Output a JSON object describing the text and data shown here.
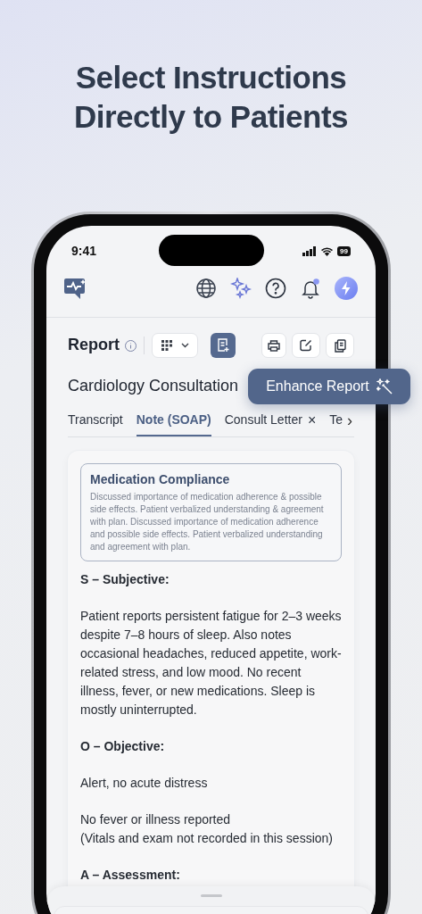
{
  "headline": "Select Instructions Directly to Patients",
  "status_bar": {
    "time": "9:41",
    "battery": "99"
  },
  "toolbar": {
    "has_notification": true
  },
  "report": {
    "title": "Report"
  },
  "consultation_title": "Cardiology Consultation",
  "enhance_button": {
    "label": "Enhance Report"
  },
  "tabs": [
    {
      "label": "Transcript",
      "selected": false,
      "closable": false
    },
    {
      "label": "Note (SOAP)",
      "selected": true,
      "closable": false
    },
    {
      "label": "Consult Letter",
      "selected": false,
      "closable": true
    },
    {
      "label": "Te",
      "selected": false,
      "closable": false
    }
  ],
  "tab_close": "×",
  "tab_more": "›",
  "note": {
    "callout": {
      "title": "Medication Compliance",
      "text": "Discussed importance of medication adherence & possible side effects. Patient verbalized understanding & agreement with plan. Discussed importance of medication adherence and possible side effects. Patient verbalized understanding and agreement with plan."
    },
    "blocks": [
      {
        "kind": "heading",
        "text": "S – Subjective:"
      },
      {
        "kind": "paragraph",
        "text": "Patient reports persistent fatigue for 2–3 weeks despite 7–8 hours of sleep. Also notes occasional headaches, reduced appetite, work-related stress, and low mood. No recent illness, fever, or new medications. Sleep is mostly uninterrupted."
      },
      {
        "kind": "heading",
        "text": "O – Objective:"
      },
      {
        "kind": "paragraph",
        "text": "Alert, no acute distress"
      },
      {
        "kind": "lines",
        "lines": [
          "No fever or illness reported",
          "(Vitals and exam not recorded in this session)"
        ]
      },
      {
        "kind": "heading",
        "text": "A – Assessment:"
      }
    ]
  }
}
